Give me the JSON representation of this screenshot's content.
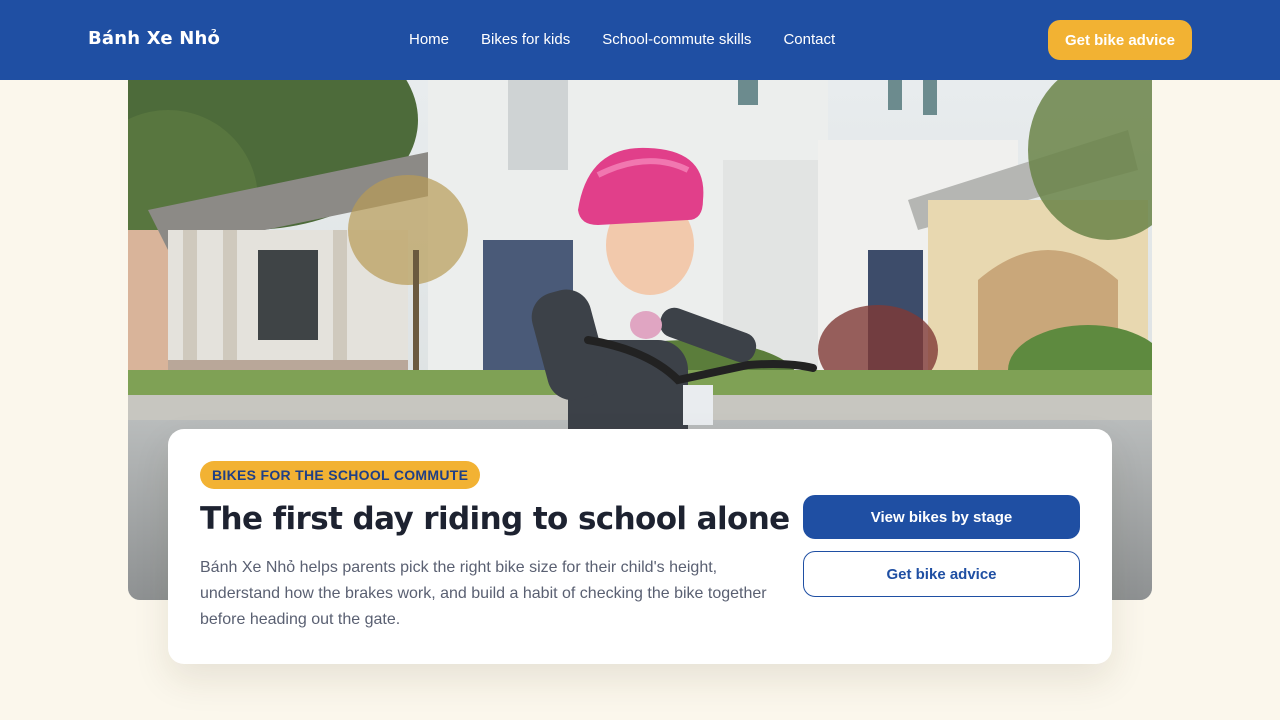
{
  "header": {
    "brand": "Bánh Xe Nhỏ",
    "nav": [
      "Home",
      "Bikes for kids",
      "School-commute skills",
      "Contact"
    ],
    "cta_label": "Get bike advice"
  },
  "hero": {
    "image_alt": "Girl in a pink helmet riding a bike on a residential street"
  },
  "card": {
    "badge": "BIKES FOR THE SCHOOL COMMUTE",
    "headline": "The first day riding to school alone",
    "description": "Bánh Xe Nhỏ helps parents pick the right bike size for their child's height, understand how the brakes work, and build a habit of checking the bike together before heading out the gate.",
    "primary_button": "View bikes by stage",
    "secondary_button": "Get bike advice"
  },
  "colors": {
    "brand_blue": "#1f4fa3",
    "accent_yellow": "#f2b233",
    "page_background": "#fbf7ec"
  }
}
